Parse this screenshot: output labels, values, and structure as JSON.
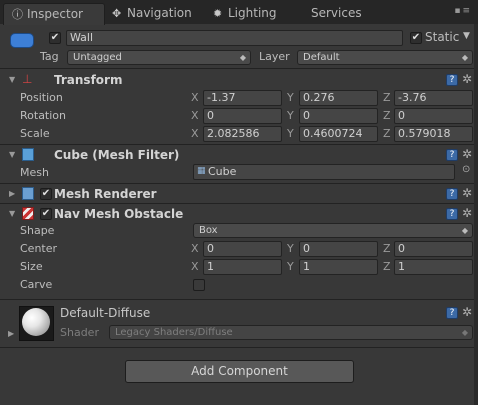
{
  "tabs": [
    {
      "label": "Inspector",
      "icon": "info-icon",
      "glyph": "ⓘ"
    },
    {
      "label": "Navigation",
      "icon": "navigation-icon",
      "glyph": "✥"
    },
    {
      "label": "Lighting",
      "icon": "lighting-icon",
      "glyph": "✹"
    },
    {
      "label": "Services",
      "icon": "services-icon",
      "glyph": ""
    }
  ],
  "object": {
    "name": "Wall",
    "active": true,
    "static_label": "Static",
    "static_checked": true,
    "tag_label": "Tag",
    "tag_value": "Untagged",
    "layer_label": "Layer",
    "layer_value": "Default"
  },
  "transform": {
    "title": "Transform",
    "rows": [
      {
        "label": "Position",
        "x": "-1.37",
        "y": "0.276",
        "z": "-3.76"
      },
      {
        "label": "Rotation",
        "x": "0",
        "y": "0",
        "z": "0"
      },
      {
        "label": "Scale",
        "x": "2.082586",
        "y": "0.4600724",
        "z": "0.579018"
      }
    ]
  },
  "axis": {
    "x": "X",
    "y": "Y",
    "z": "Z"
  },
  "mesh_filter": {
    "title": "Cube (Mesh Filter)",
    "mesh_label": "Mesh",
    "mesh_value": "Cube"
  },
  "mesh_renderer": {
    "title": "Mesh Renderer",
    "enabled": true
  },
  "nav_mesh_obstacle": {
    "title": "Nav Mesh Obstacle",
    "enabled": true,
    "shape_label": "Shape",
    "shape_value": "Box",
    "center": {
      "label": "Center",
      "x": "0",
      "y": "0",
      "z": "0"
    },
    "size": {
      "label": "Size",
      "x": "1",
      "y": "1",
      "z": "1"
    },
    "carve_label": "Carve",
    "carve_checked": false
  },
  "material": {
    "name": "Default-Diffuse",
    "shader_label": "Shader",
    "shader_value": "Legacy Shaders/Diffuse"
  },
  "add_component_label": "Add Component",
  "help_glyph": "?",
  "colors": {
    "background": "#383838",
    "tab_bar": "#262626",
    "field": "#454545",
    "book_icon": "#3c6aa6"
  }
}
